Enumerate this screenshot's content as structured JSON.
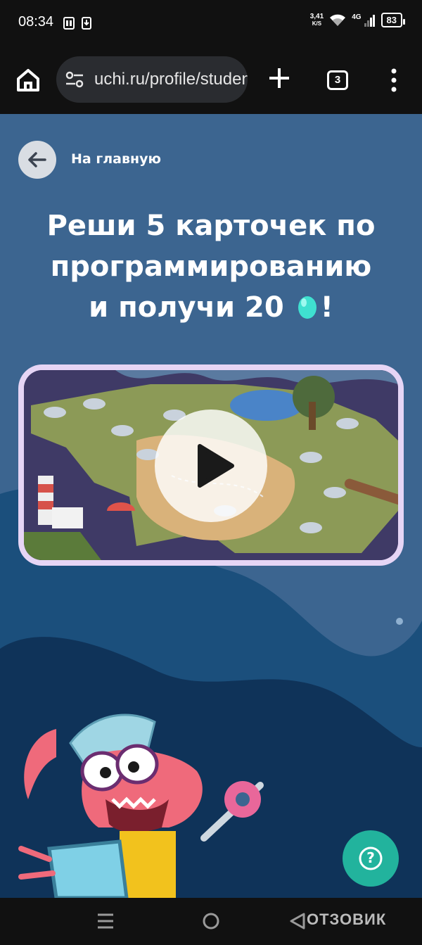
{
  "status_bar": {
    "time": "08:34",
    "net_speed_value": "3,41",
    "net_speed_unit": "K/S",
    "network_type": "4G",
    "battery": "83",
    "icons": [
      "sim-icon",
      "download-icon",
      "wifi-icon",
      "signal-icon",
      "battery-icon"
    ]
  },
  "browser": {
    "url": "uchi.ru/profile/students",
    "tabs_count": "3",
    "icons": [
      "home-icon",
      "tune-icon",
      "plus-icon",
      "menu-dots-icon"
    ]
  },
  "page": {
    "back_label": "На главную",
    "title_line1": "Реши 5 карточек по",
    "title_line2": "программированию",
    "title_line3_prefix": "и получи 20",
    "title_line3_suffix": "!",
    "reward_icon": "egg-icon",
    "video_play_icon": "play-icon",
    "help_label": "?"
  },
  "nav_bar": {
    "icons": [
      "recent-apps-icon",
      "home-circle-icon",
      "back-triangle-icon"
    ],
    "watermark": "ОТЗОВИК"
  },
  "colors": {
    "page_bg": "#3c6590",
    "page_bg_dark": "#0f3359",
    "accent_help": "#22b39d",
    "video_border": "#e6d5f5",
    "egg": "#3fe0d0"
  }
}
